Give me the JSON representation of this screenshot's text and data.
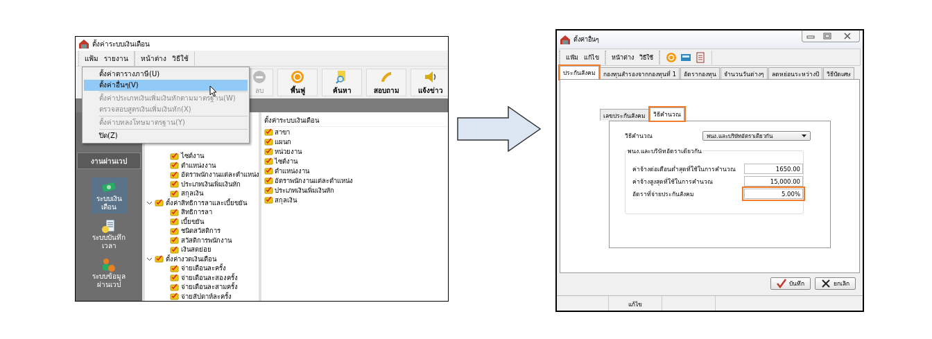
{
  "left_window": {
    "title": "ตั้งค่าระบบเงินเดือน",
    "menu_groups": [
      [
        "แฟ้ม",
        "รายงาน"
      ],
      [
        "หน้าต่าง",
        "วิธีใช้"
      ]
    ],
    "toolbar": [
      {
        "label": "ลบ",
        "kind": "delete",
        "disabled": true
      },
      {
        "label": "พื้นฟู",
        "kind": "restore",
        "disabled": false
      },
      {
        "label": "ค้นหา",
        "kind": "search",
        "disabled": false
      },
      {
        "label": "สอบถาม",
        "kind": "phone",
        "disabled": false
      },
      {
        "label": "แจ้งข่าว",
        "kind": "speaker",
        "disabled": false
      }
    ],
    "dropdown": [
      {
        "kind": "item",
        "label": "ตั้งค่าตารางภาษี(U)",
        "disabled": false,
        "selected": false
      },
      {
        "kind": "item",
        "label": "ตั้งค่าอื่นๆ(V)",
        "disabled": false,
        "selected": true
      },
      {
        "kind": "separator"
      },
      {
        "kind": "item",
        "label": "ตั้งค่าประเภทเงินเพิ่มเงินหักตามมาตรฐาน(W)",
        "disabled": true,
        "selected": false
      },
      {
        "kind": "item",
        "label": "ตรวจสอบสูตรเงินเพิ่มเงินหัก(X)",
        "disabled": true,
        "selected": false
      },
      {
        "kind": "separator"
      },
      {
        "kind": "item",
        "label": "ตั้งค่าบทลงโทษมาตรฐาน(Y)",
        "disabled": true,
        "selected": false
      },
      {
        "kind": "separator"
      },
      {
        "kind": "item",
        "label": "ปิด(Z)",
        "disabled": false,
        "selected": false
      }
    ],
    "sidebar": {
      "section_button": "งานผ่านเวป",
      "modules": [
        {
          "label": "ระบบเงินเดือน",
          "kind": "money",
          "selected": true
        },
        {
          "label": "ระบบบันทึกเวลา",
          "kind": "clock",
          "selected": false
        },
        {
          "label": "ระบบข้อมูลผ่านเวป",
          "kind": "people",
          "selected": false
        }
      ]
    },
    "tree": [
      {
        "children": [
          "ไซต์งาน",
          "ตำแหน่งงาน",
          "อัตราพนักงานแต่ละตำแหน่ง",
          "ประเภทเงินเพิ่มเงินหัก",
          "สกุลเงิน"
        ]
      },
      {
        "label": "ตั้งค่าสิทธิการลาและเบี้ยขยัน",
        "expanded": true,
        "children": [
          "สิทธิการลา",
          "เบี้ยขยัน",
          "ชนิดสวัสดิการ",
          "สวัสดิการพนักงาน",
          "เงินสดย่อย"
        ]
      },
      {
        "label": "ตั้งค่างวดเงินเดือน",
        "expanded": true,
        "children": [
          "จ่ายเดือนละครั้ง",
          "จ่ายเดือนละสองครั้ง",
          "จ่ายเดือนละสามครั้ง",
          "จ่ายสัปดาห์ละครั้ง"
        ]
      }
    ],
    "list": {
      "header": "ตั้งค่าระบบเงินเดือน",
      "items": [
        "สาขา",
        "แผนก",
        "หน่วยงาน",
        "ไซต์งาน",
        "ตำแหน่งงาน",
        "อัตราพนักงานแต่ละตำแหน่ง",
        "ประเภทเงินเพิ่มเงินหัก",
        "สกุลเงิน"
      ]
    }
  },
  "right_window": {
    "title": "ตั้งค่าอื่นๆ",
    "menu_groups": [
      [
        "แฟ้ม",
        "แก้ไข"
      ],
      [
        "หน้าต่าง",
        "วิธีใช้"
      ]
    ],
    "toolbar_icons": [
      {
        "kind": "target"
      },
      {
        "kind": "calculator"
      },
      {
        "kind": "document"
      }
    ],
    "tabs": [
      {
        "label": "ประกันสังคม",
        "selected": true,
        "highlighted": true
      },
      {
        "label": "กองทุนสำรองจากกองทุนที่ 1",
        "selected": false,
        "highlighted": false
      },
      {
        "label": "อัตรากองทุน",
        "selected": false,
        "highlighted": false
      },
      {
        "label": "จำนวนวันต่างๆ",
        "selected": false,
        "highlighted": false
      },
      {
        "label": "ลดหย่อนระหว่างปี",
        "selected": false,
        "highlighted": false
      },
      {
        "label": "วิธีปัดเศษ",
        "selected": false,
        "highlighted": false
      }
    ],
    "inner_tabs": [
      {
        "label": "เลขประกันสังคม",
        "selected": false,
        "highlighted": false
      },
      {
        "label": "วิธีคำนวณ",
        "selected": true,
        "highlighted": true
      }
    ],
    "method": {
      "label": "วิธีคำนวณ",
      "value": "พนง.และบริษัทอัตราเดียวกัน"
    },
    "group": {
      "title": "พนง.และบริษัทอัตราเดียวกัน",
      "fields": [
        {
          "label": "ค่าจ้างต่อเดือนต่ำสุดที่ใช้ในการคำนวณ",
          "value": "1650.00",
          "highlighted": false
        },
        {
          "label": "ค่าจ้างสูงสุดที่ใช้ในการคำนวณ",
          "value": "15,000.00",
          "highlighted": false
        },
        {
          "label": "อัตราที่จ่ายประกันสังคม",
          "value": "5.00%",
          "highlighted": true
        }
      ]
    },
    "buttons": [
      {
        "label": "บันทึก",
        "kind": "save"
      },
      {
        "label": "ยกเลิก",
        "kind": "cancel"
      }
    ],
    "status_bar": [
      "แก้ไข"
    ]
  }
}
